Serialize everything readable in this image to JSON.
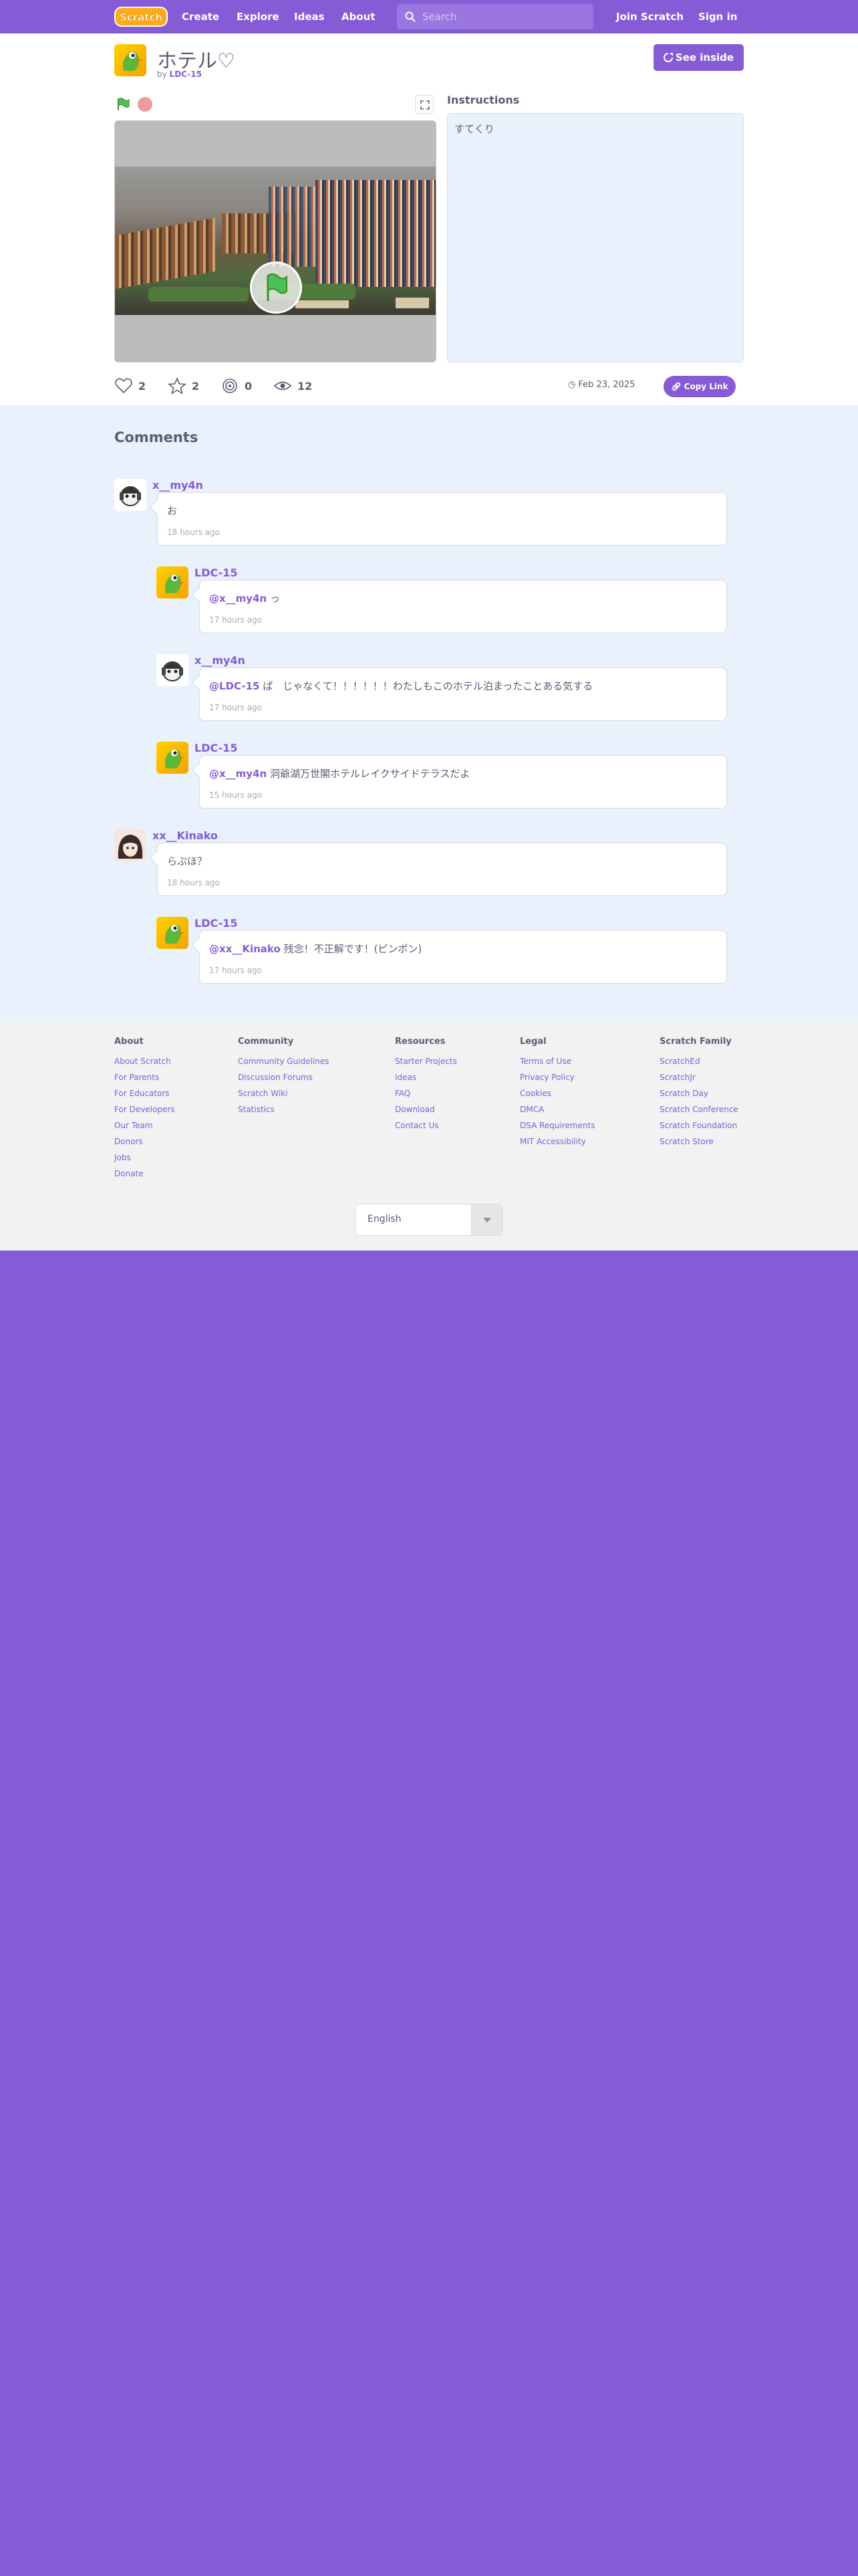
{
  "nav": {
    "logo": "Scratch",
    "items": [
      "Create",
      "Explore",
      "Ideas",
      "About"
    ],
    "search_placeholder": "Search",
    "join": "Join Scratch",
    "signin": "Sign in"
  },
  "project": {
    "title": "ホテル♡",
    "by_prefix": "by",
    "author": "LDC-15",
    "see_inside": "See inside",
    "instructions_label": "Instructions",
    "instructions": "すてくり",
    "stats": {
      "loves": "2",
      "favorites": "2",
      "remixes": "0",
      "views": "12"
    },
    "date": "Feb 23, 2025",
    "copy_link": "Copy Link"
  },
  "comments": {
    "heading": "Comments",
    "items": [
      {
        "user": "x__my4n",
        "mention": "",
        "text": "お",
        "time": "18 hours ago"
      },
      {
        "user": "LDC-15",
        "mention": "@x__my4n",
        "text": " っ",
        "time": "17 hours ago"
      },
      {
        "user": "x__my4n",
        "mention": "@LDC-15",
        "text": " ぱ　じゃなくて！！！！！！わたしもこのホテル泊まったことある気する",
        "time": "17 hours ago"
      },
      {
        "user": "LDC-15",
        "mention": "@x__my4n",
        "text": " 洞爺湖万世閣ホテルレイクサイドテラスだよ",
        "time": "15 hours ago"
      },
      {
        "user": "xx__Kinako",
        "mention": "",
        "text": "らぷほ？",
        "time": "18 hours ago"
      },
      {
        "user": "LDC-15",
        "mention": "@xx__Kinako",
        "text": " 残念！不正解です！(ピンポン)",
        "time": "17 hours ago"
      }
    ]
  },
  "footer": {
    "about": {
      "title": "About",
      "links": [
        "About Scratch",
        "For Parents",
        "For Educators",
        "For Developers",
        "Our Team",
        "Donors",
        "Jobs",
        "Donate"
      ]
    },
    "community": {
      "title": "Community",
      "links": [
        "Community Guidelines",
        "Discussion Forums",
        "Scratch Wiki",
        "Statistics"
      ]
    },
    "resources": {
      "title": "Resources",
      "links": [
        "Starter Projects",
        "Ideas",
        "FAQ",
        "Download",
        "Contact Us"
      ]
    },
    "legal": {
      "title": "Legal",
      "links": [
        "Terms of Use",
        "Privacy Policy",
        "Cookies",
        "DMCA",
        "DSA Requirements",
        "MIT Accessibility"
      ]
    },
    "family": {
      "title": "Scratch Family",
      "links": [
        "ScratchEd",
        "ScratchJr",
        "Scratch Day",
        "Scratch Conference",
        "Scratch Foundation",
        "Scratch Store"
      ]
    },
    "language": "English"
  },
  "colors": {
    "brand": "#855cd6",
    "comments_bg": "#e9f1fc",
    "footer_bg": "#f2f2f2"
  }
}
